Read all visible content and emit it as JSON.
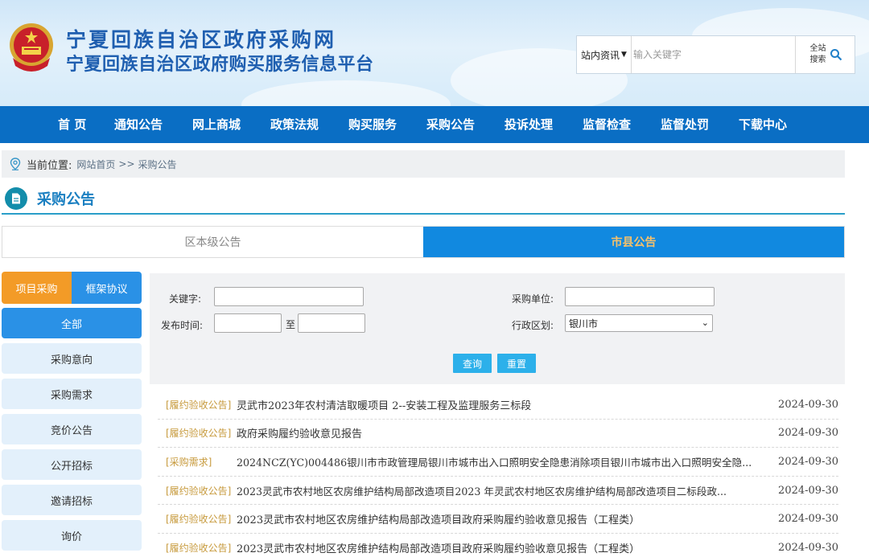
{
  "header": {
    "title": "宁夏回族自治区政府采购网",
    "subtitle": "宁夏回族自治区政府购买服务信息平台",
    "emblem_icon": "national-emblem-icon",
    "search": {
      "scope_label": "站内资讯",
      "placeholder": "输入关键字",
      "button_label": "全站搜索"
    }
  },
  "nav": [
    "首 页",
    "通知公告",
    "网上商城",
    "政策法规",
    "购买服务",
    "采购公告",
    "投诉处理",
    "监督检查",
    "监督处罚",
    "下载中心"
  ],
  "breadcrumb": {
    "label": "当前位置:",
    "items": [
      "网站首页",
      "采购公告"
    ],
    "separator": ">>"
  },
  "section": {
    "title": "采购公告"
  },
  "level_tabs": {
    "district": "区本级公告",
    "city": "市县公告",
    "active": "市县公告"
  },
  "sidebar": {
    "toggle": {
      "project": "项目采购",
      "framework": "框架协议",
      "active": "项目采购"
    },
    "items": [
      "全部",
      "采购意向",
      "采购需求",
      "竞价公告",
      "公开招标",
      "邀请招标",
      "询价"
    ],
    "active": "全部"
  },
  "filter": {
    "keyword_label": "关键字:",
    "unit_label": "采购单位:",
    "date_label": "发布时间:",
    "date_to": "至",
    "region_label": "行政区划:",
    "region_value": "银川市",
    "query_button": "查询",
    "reset_button": "重置"
  },
  "notices": [
    {
      "tag": "[履约验收公告]",
      "title": "灵武市2023年农村清洁取暖项目 2--安装工程及监理服务三标段",
      "date": "2024-09-30"
    },
    {
      "tag": "[履约验收公告]",
      "title": "政府采购履约验收意见报告",
      "date": "2024-09-30"
    },
    {
      "tag": "[采购需求]",
      "title": "2024NCZ(YC)004486银川市市政管理局银川市城市出入口照明安全隐患消除项目银川市城市出入口照明安全隐...",
      "date": "2024-09-30"
    },
    {
      "tag": "[履约验收公告]",
      "title": "2023灵武市农村地区农房维护结构局部改造项目2023 年灵武农村地区农房维护结构局部改造项目二标段政...",
      "date": "2024-09-30"
    },
    {
      "tag": "[履约验收公告]",
      "title": "2023灵武市农村地区农房维护结构局部改造项目政府采购履约验收意见报告（工程类）",
      "date": "2024-09-30"
    },
    {
      "tag": "[履约验收公告]",
      "title": "2023灵武市农村地区农房维护结构局部改造项目政府采购履约验收意见报告（工程类）",
      "date": "2024-09-30"
    }
  ],
  "colors": {
    "nav_bg": "#0a6ec4",
    "title_blue": "#1f5fb0",
    "active_tab": "#1189e0",
    "active_tab_text": "#f7c16a",
    "toggle_active": "#f39b27",
    "tag_color": "#c79a3c",
    "button_cyan": "#2cb0ea"
  }
}
